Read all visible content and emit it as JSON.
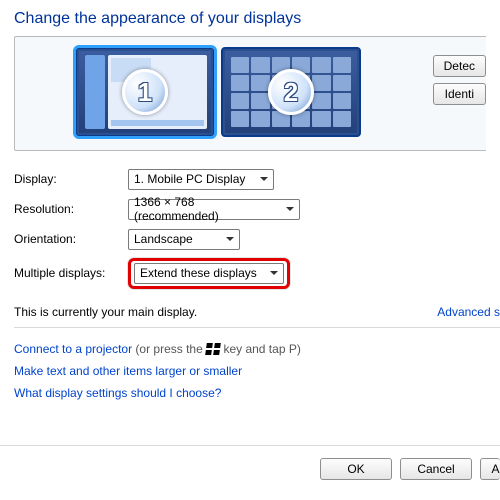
{
  "title": "Change the appearance of your displays",
  "monitors": {
    "num1": "1",
    "num2": "2"
  },
  "side_buttons": {
    "detect": "Detec",
    "identify": "Identi"
  },
  "form": {
    "display_label": "Display:",
    "display_value": "1. Mobile PC Display",
    "resolution_label": "Resolution:",
    "resolution_value": "1366 × 768 (recommended)",
    "orientation_label": "Orientation:",
    "orientation_value": "Landscape",
    "multiple_label": "Multiple displays:",
    "multiple_value": "Extend these displays"
  },
  "main_display_text": "This is currently your main display.",
  "advanced_link": "Advanced s",
  "links": {
    "projector_pre": "Connect to a projector",
    "projector_post": " (or press the ",
    "projector_tail": " key and tap P)",
    "larger": "Make text and other items larger or smaller",
    "which": "What display settings should I choose?"
  },
  "footer": {
    "ok": "OK",
    "cancel": "Cancel",
    "apply": "A"
  }
}
